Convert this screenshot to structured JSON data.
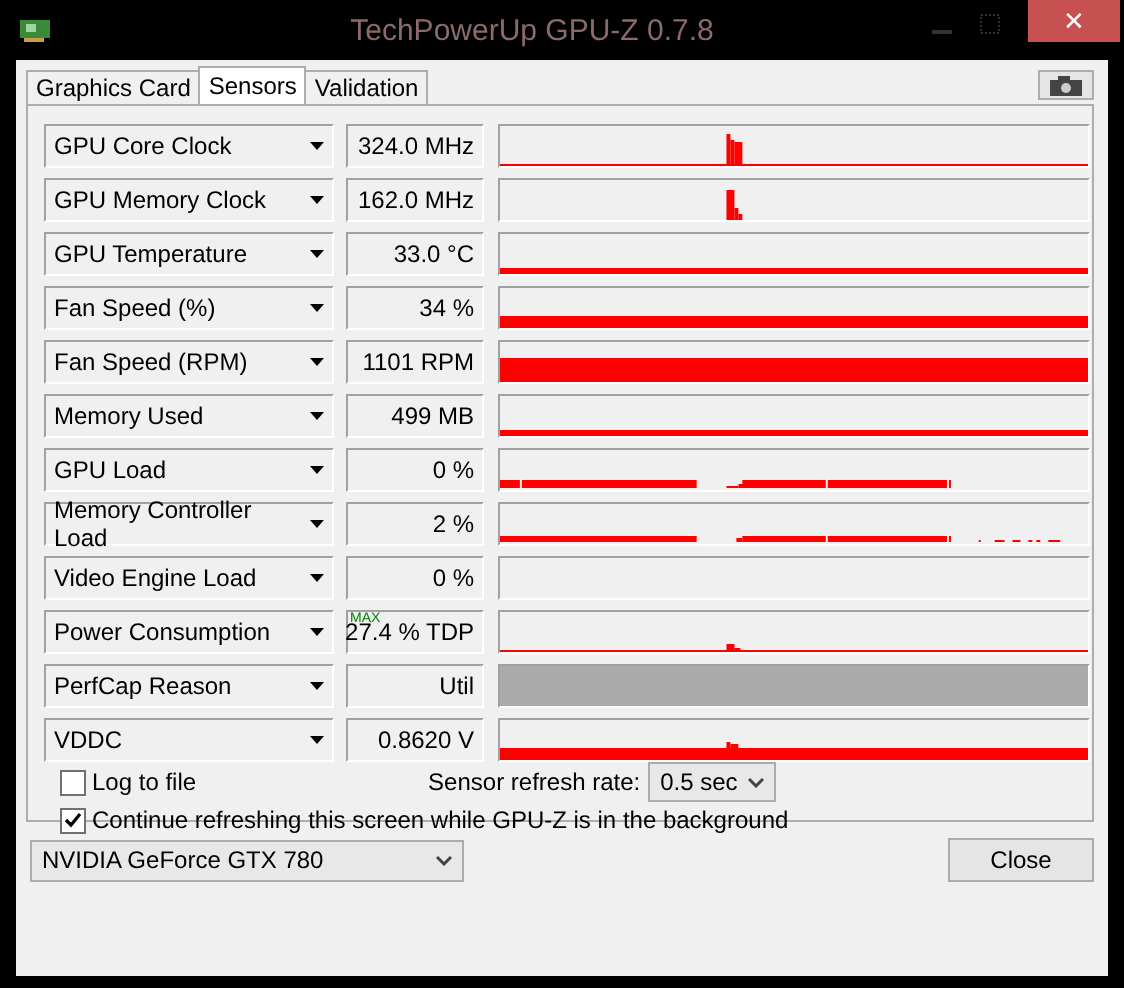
{
  "window": {
    "title": "TechPowerUp GPU-Z 0.7.8",
    "close": "✕"
  },
  "tabs": [
    {
      "label": "Graphics Card",
      "selected": false
    },
    {
      "label": "Sensors",
      "selected": true
    },
    {
      "label": "Validation",
      "selected": false
    }
  ],
  "sensors": [
    {
      "label": "GPU Core Clock",
      "value": "324.0 MHz",
      "kind": "graph"
    },
    {
      "label": "GPU Memory Clock",
      "value": "162.0 MHz",
      "kind": "graph"
    },
    {
      "label": "GPU Temperature",
      "value": "33.0 °C",
      "kind": "graph"
    },
    {
      "label": "Fan Speed (%)",
      "value": "34 %",
      "kind": "graph"
    },
    {
      "label": "Fan Speed (RPM)",
      "value": "1101 RPM",
      "kind": "graph"
    },
    {
      "label": "Memory Used",
      "value": "499 MB",
      "kind": "graph"
    },
    {
      "label": "GPU Load",
      "value": "0 %",
      "kind": "graph"
    },
    {
      "label": "Memory Controller Load",
      "value": "2 %",
      "kind": "graph"
    },
    {
      "label": "Video Engine Load",
      "value": "0 %",
      "kind": "graph"
    },
    {
      "label": "Power Consumption",
      "value": "27.4 % TDP",
      "badge": "MAX",
      "kind": "graph"
    },
    {
      "label": "PerfCap Reason",
      "value": "Util",
      "kind": "state"
    },
    {
      "label": "VDDC",
      "value": "0.8620 V",
      "kind": "graph"
    }
  ],
  "log_to_file": {
    "label": "Log to file",
    "checked": false
  },
  "refresh_rate": {
    "label": "Sensor refresh rate:",
    "value": "0.5 sec"
  },
  "continue_refreshing": {
    "label": "Continue refreshing this screen while GPU-Z is in the background",
    "checked": true
  },
  "gpu_select": {
    "value": "NVIDIA GeForce GTX 780"
  },
  "close_button": "Close"
}
